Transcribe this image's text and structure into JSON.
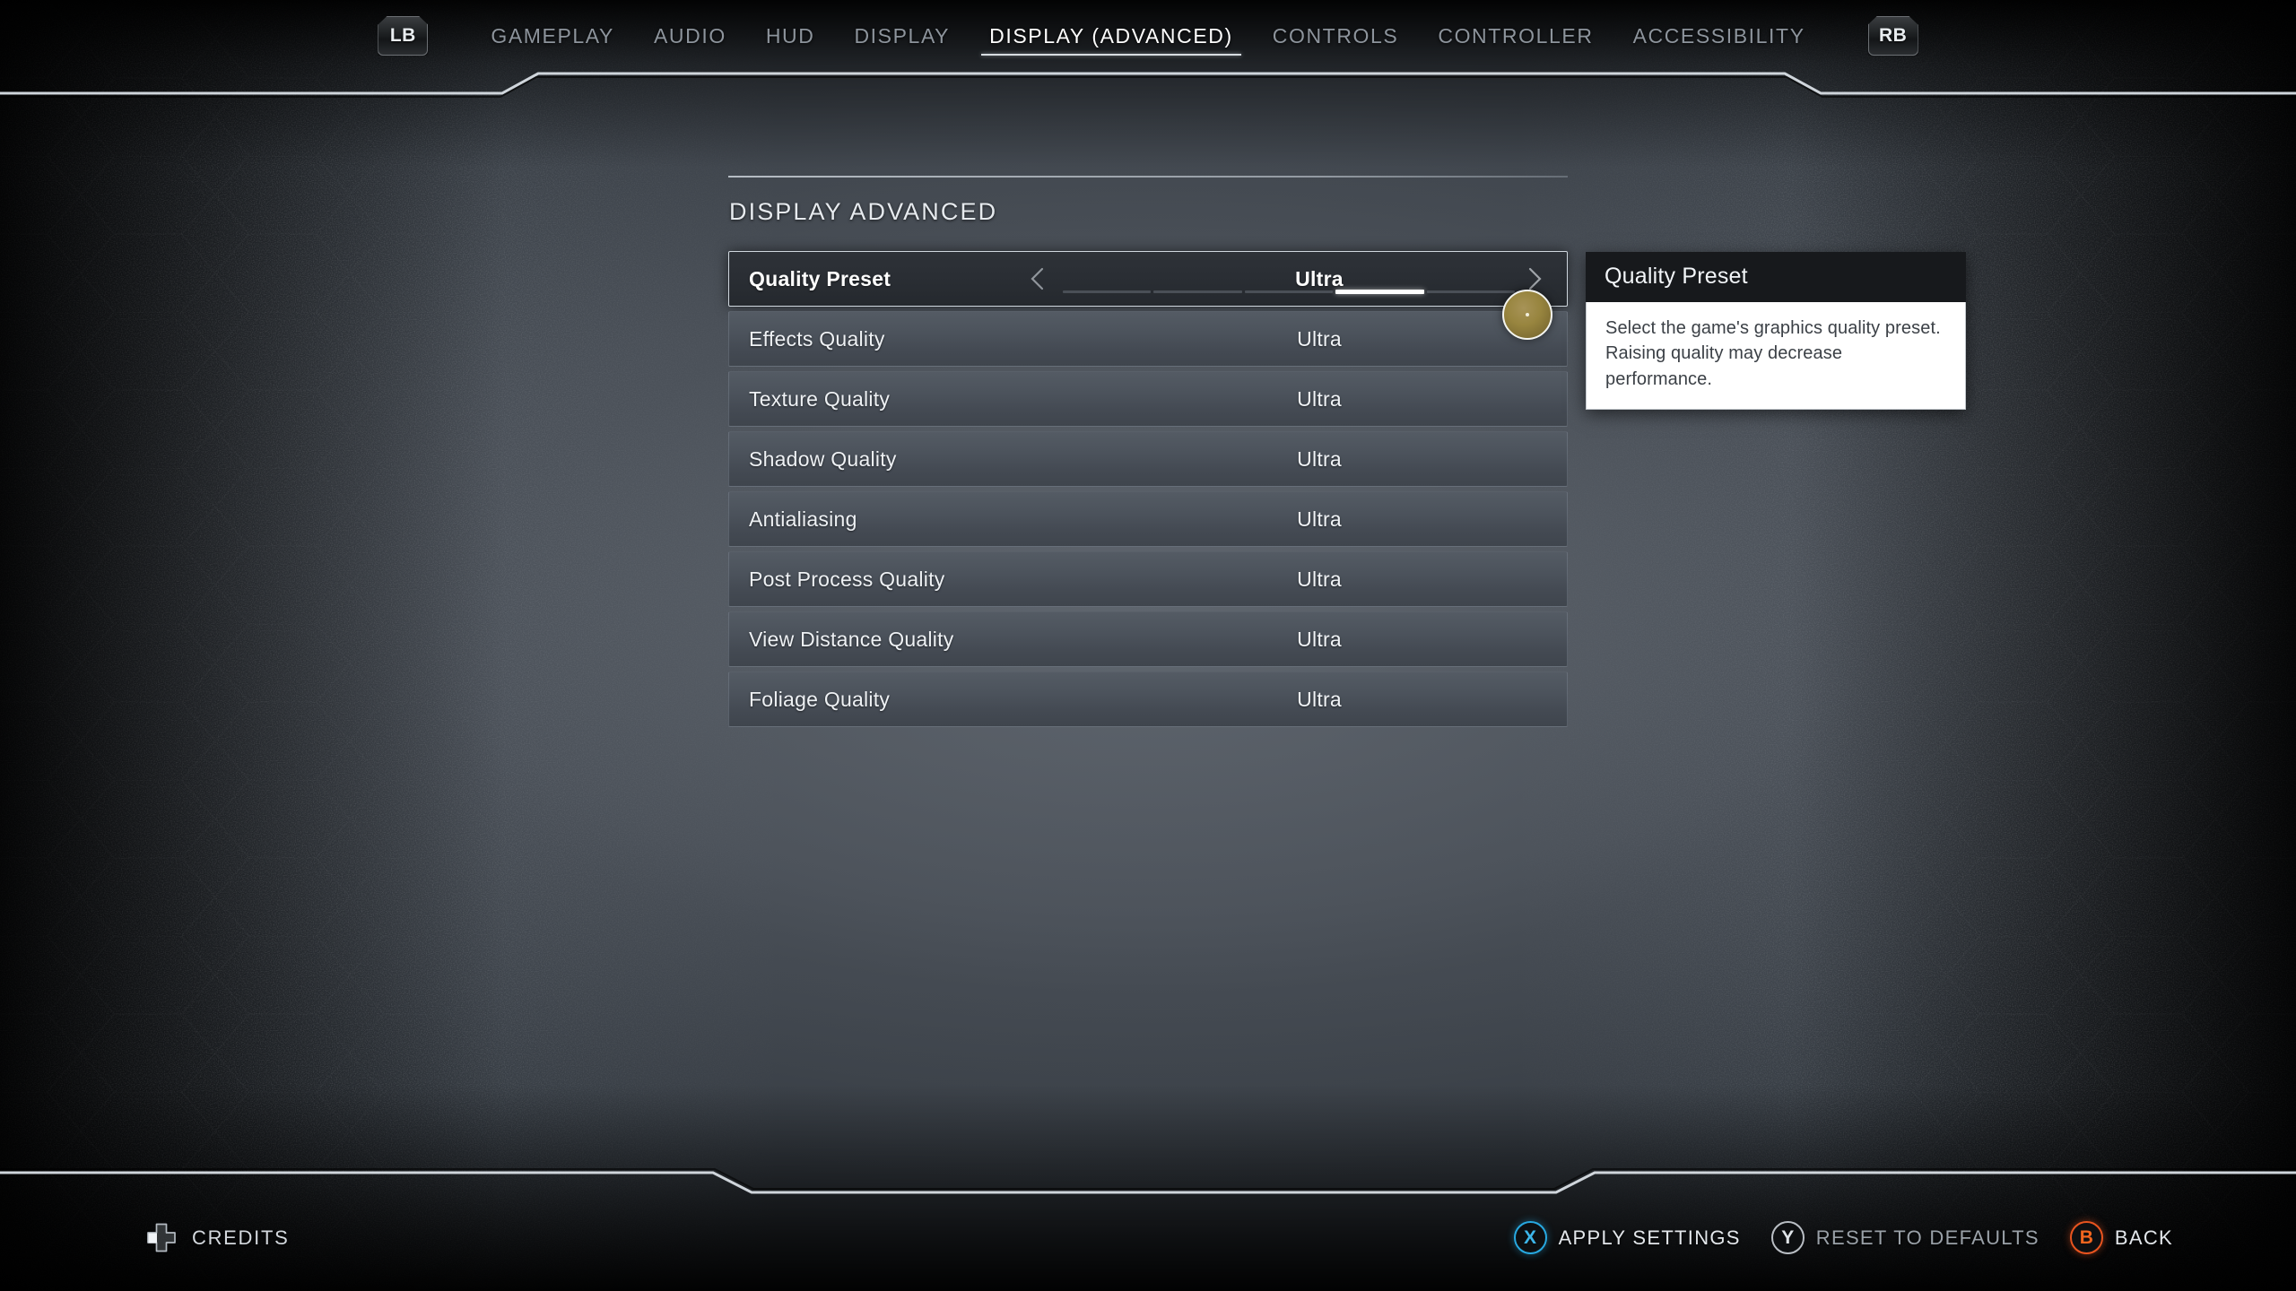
{
  "header": {
    "shoulder_left": "LB",
    "shoulder_right": "RB",
    "tabs": [
      {
        "label": "GAMEPLAY",
        "active": false
      },
      {
        "label": "AUDIO",
        "active": false
      },
      {
        "label": "HUD",
        "active": false
      },
      {
        "label": "DISPLAY",
        "active": false
      },
      {
        "label": "DISPLAY (ADVANCED)",
        "active": true
      },
      {
        "label": "CONTROLS",
        "active": false
      },
      {
        "label": "CONTROLLER",
        "active": false
      },
      {
        "label": "ACCESSIBILITY",
        "active": false
      }
    ]
  },
  "panel": {
    "title": "DISPLAY ADVANCED",
    "rows": [
      {
        "label": "Quality Preset",
        "value": "Ultra",
        "selected": true,
        "segments": 5,
        "active_segment": 4
      },
      {
        "label": "Effects Quality",
        "value": "Ultra",
        "selected": false
      },
      {
        "label": "Texture Quality",
        "value": "Ultra",
        "selected": false
      },
      {
        "label": "Shadow Quality",
        "value": "Ultra",
        "selected": false
      },
      {
        "label": "Antialiasing",
        "value": "Ultra",
        "selected": false
      },
      {
        "label": "Post Process Quality",
        "value": "Ultra",
        "selected": false
      },
      {
        "label": "View Distance Quality",
        "value": "Ultra",
        "selected": false
      },
      {
        "label": "Foliage Quality",
        "value": "Ultra",
        "selected": false
      }
    ]
  },
  "tooltip": {
    "title": "Quality Preset",
    "body": "Select the game's graphics quality preset. Raising quality may decrease performance."
  },
  "footer": {
    "credits_label": "CREDITS",
    "credits_icon": "dpad-left-icon",
    "prompts": [
      {
        "glyph": "X",
        "label": "APPLY SETTINGS",
        "style": "x",
        "dim": false
      },
      {
        "glyph": "Y",
        "label": "RESET TO DEFAULTS",
        "style": "y",
        "dim": true
      },
      {
        "glyph": "B",
        "label": "BACK",
        "style": "b",
        "dim": false
      }
    ]
  },
  "colors": {
    "accent_blue": "#27a8e0",
    "accent_orange": "#e8541f",
    "cursor_gold": "#98853f",
    "row_bg": "#4b525b",
    "row_selected_bg": "#2a2e34",
    "tooltip_header_bg": "#17191c",
    "tooltip_body_bg": "#ffffff"
  }
}
